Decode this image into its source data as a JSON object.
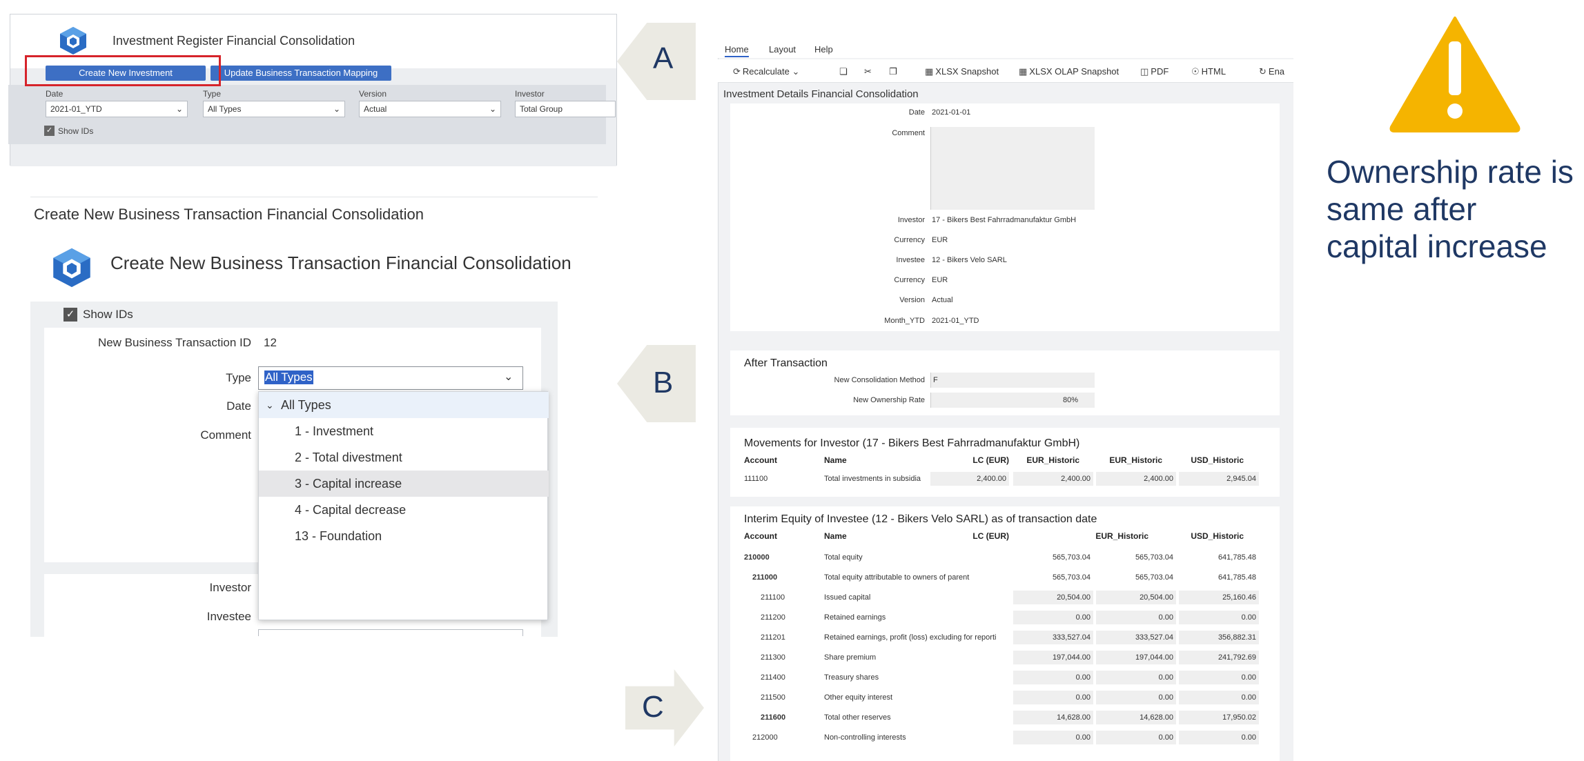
{
  "panel_a": {
    "title": "Investment Register Financial Consolidation",
    "create_button": "Create New Investment",
    "update_button": "Update Business Transaction Mapping",
    "filters": [
      {
        "label": "Date",
        "value": "2021-01_YTD"
      },
      {
        "label": "Type",
        "value": "All Types"
      },
      {
        "label": "Version",
        "value": "Actual"
      },
      {
        "label": "Investor",
        "value": "Total Group"
      }
    ],
    "show_ids": "Show IDs",
    "arrow_letter": "A"
  },
  "panel_b": {
    "outer_title": "Create New Business Transaction Financial Consolidation",
    "title": "Create New Business Transaction Financial Consolidation",
    "show_ids": "Show IDs",
    "labels": {
      "transaction_id": "New Business Transaction ID",
      "type": "Type",
      "date": "Date",
      "comment": "Comment",
      "investor": "Investor",
      "investee": "Investee"
    },
    "transaction_id_value": "12",
    "type_value": "All Types",
    "dropdown": [
      "All Types",
      "1 - Investment",
      "2 - Total divestment",
      "3 - Capital increase",
      "4 - Capital decrease",
      "13 - Foundation"
    ],
    "arrow_letter": "B"
  },
  "panel_c": {
    "menu": [
      "Home",
      "Layout",
      "Help"
    ],
    "toolbar": [
      "Recalculate",
      "XLSX Snapshot",
      "XLSX OLAP Snapshot",
      "PDF",
      "HTML",
      "Ena"
    ],
    "sheet_title": "Investment Details Financial Consolidation",
    "details": {
      "date_label": "Date",
      "date_value": "2021-01-01",
      "comment_label": "Comment",
      "investor_label": "Investor",
      "investor_value": "17 - Bikers Best Fahrradmanufaktur GmbH",
      "currency1_label": "Currency",
      "currency1_value": "EUR",
      "investee_label": "Investee",
      "investee_value": "12 - Bikers Velo SARL",
      "currency2_label": "Currency",
      "currency2_value": "EUR",
      "version_label": "Version",
      "version_value": "Actual",
      "month_label": "Month_YTD",
      "month_value": "2021-01_YTD"
    },
    "after": {
      "heading": "After Transaction",
      "method_label": "New Consolidation Method",
      "method_value": "F",
      "rate_label": "New Ownership Rate",
      "rate_value": "80%"
    },
    "movements": {
      "heading": "Movements for Investor (17 - Bikers Best Fahrradmanufaktur GmbH)",
      "columns": [
        "Account",
        "Name",
        "LC (EUR)",
        "EUR_Historic",
        "EUR_Historic",
        "USD_Historic"
      ],
      "rows": [
        {
          "account": "111100",
          "name": "Total investments in subsidia",
          "v": [
            "2,400.00",
            "2,400.00",
            "2,400.00",
            "2,945.04"
          ]
        }
      ]
    },
    "equity": {
      "heading": "Interim Equity of Investee (12 - Bikers Velo SARL) as of transaction date",
      "columns": [
        "Account",
        "Name",
        "LC (EUR)",
        "EUR_Historic",
        "USD_Historic"
      ],
      "rows": [
        {
          "account": "210000",
          "name": "Total equity",
          "v": [
            "565,703.04",
            "565,703.04",
            "641,785.48"
          ]
        },
        {
          "account": "211000",
          "name": "Total equity attributable to owners of parent",
          "v": [
            "565,703.04",
            "565,703.04",
            "641,785.48"
          ]
        },
        {
          "account": "211100",
          "name": "Issued capital",
          "v": [
            "20,504.00",
            "20,504.00",
            "25,160.46"
          ]
        },
        {
          "account": "211200",
          "name": "Retained earnings",
          "v": [
            "0.00",
            "0.00",
            "0.00"
          ]
        },
        {
          "account": "211201",
          "name": "Retained earnings, profit (loss) excluding for reporti",
          "v": [
            "333,527.04",
            "333,527.04",
            "356,882.31"
          ]
        },
        {
          "account": "211300",
          "name": "Share premium",
          "v": [
            "197,044.00",
            "197,044.00",
            "241,792.69"
          ]
        },
        {
          "account": "211400",
          "name": "Treasury shares",
          "v": [
            "0.00",
            "0.00",
            "0.00"
          ]
        },
        {
          "account": "211500",
          "name": "Other equity interest",
          "v": [
            "0.00",
            "0.00",
            "0.00"
          ]
        },
        {
          "account": "211600",
          "name": "Total other reserves",
          "v": [
            "14,628.00",
            "14,628.00",
            "17,950.02"
          ]
        },
        {
          "account": "212000",
          "name": "Non-controlling interests",
          "v": [
            "0.00",
            "0.00",
            "0.00"
          ]
        }
      ]
    },
    "arrow_letter": "C"
  },
  "warning": {
    "text": "Ownership rate is same after capital increase",
    "color": "#f5b400"
  }
}
